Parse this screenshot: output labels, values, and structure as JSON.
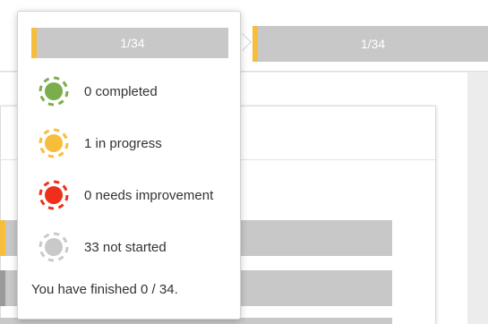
{
  "background": {
    "progress_label": "1/34"
  },
  "popover": {
    "progress_label": "1/34",
    "statuses": [
      {
        "label": "0 completed",
        "color": "#7aad4c",
        "icon": "status-dot-icon"
      },
      {
        "label": "1 in progress",
        "color": "#f6be3a",
        "icon": "status-dot-icon"
      },
      {
        "label": "0 needs improvement",
        "color": "#ef2f1c",
        "icon": "status-dot-icon"
      },
      {
        "label": "33 not started",
        "color": "#c9c9c9",
        "icon": "status-dot-icon"
      }
    ],
    "summary": "You have finished 0 / 34."
  },
  "colors": {
    "progress_accent": "#f6be3a",
    "progress_track": "#c8c8c8"
  }
}
